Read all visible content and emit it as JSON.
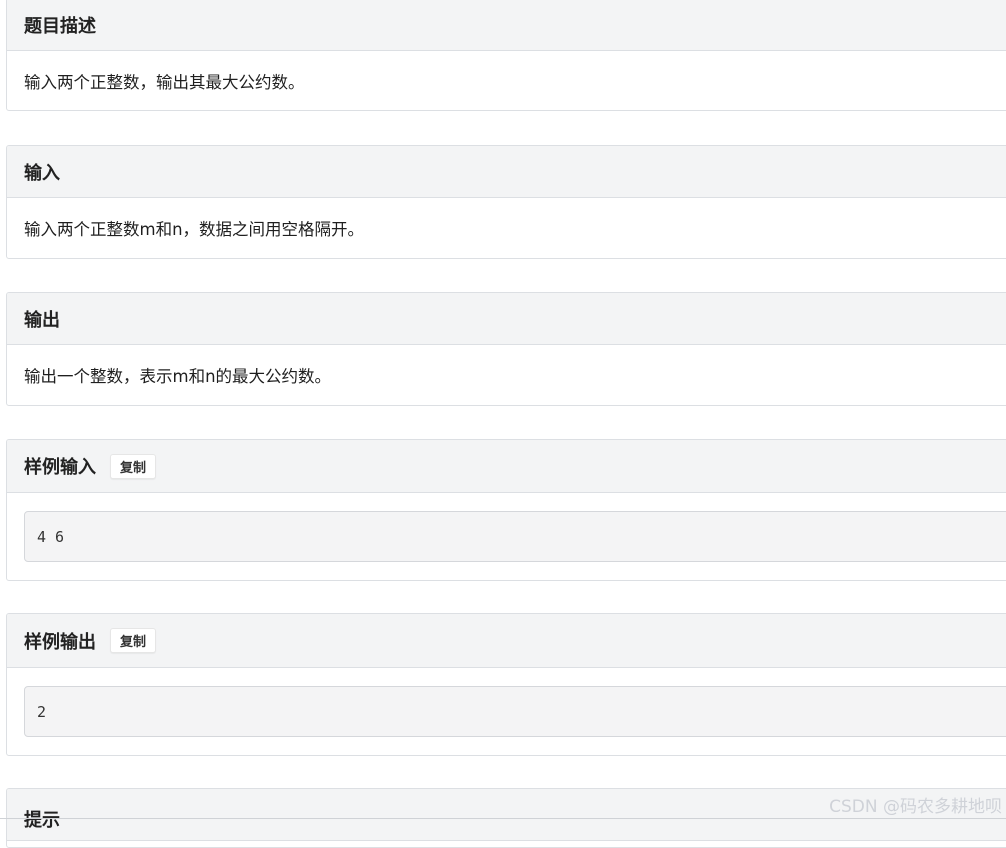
{
  "sections": {
    "description": {
      "title": "题目描述",
      "text": "输入两个正整数，输出其最大公约数。"
    },
    "input": {
      "title": "输入",
      "text": "输入两个正整数m和n，数据之间用空格隔开。"
    },
    "output": {
      "title": "输出",
      "text": "输出一个整数，表示m和n的最大公约数。"
    },
    "sample_input": {
      "title": "样例输入",
      "copy_label": "复制",
      "code": "4 6"
    },
    "sample_output": {
      "title": "样例输出",
      "copy_label": "复制",
      "code": "2"
    },
    "hint": {
      "title": "提示"
    }
  },
  "watermark": "CSDN @码农多耕地呗"
}
